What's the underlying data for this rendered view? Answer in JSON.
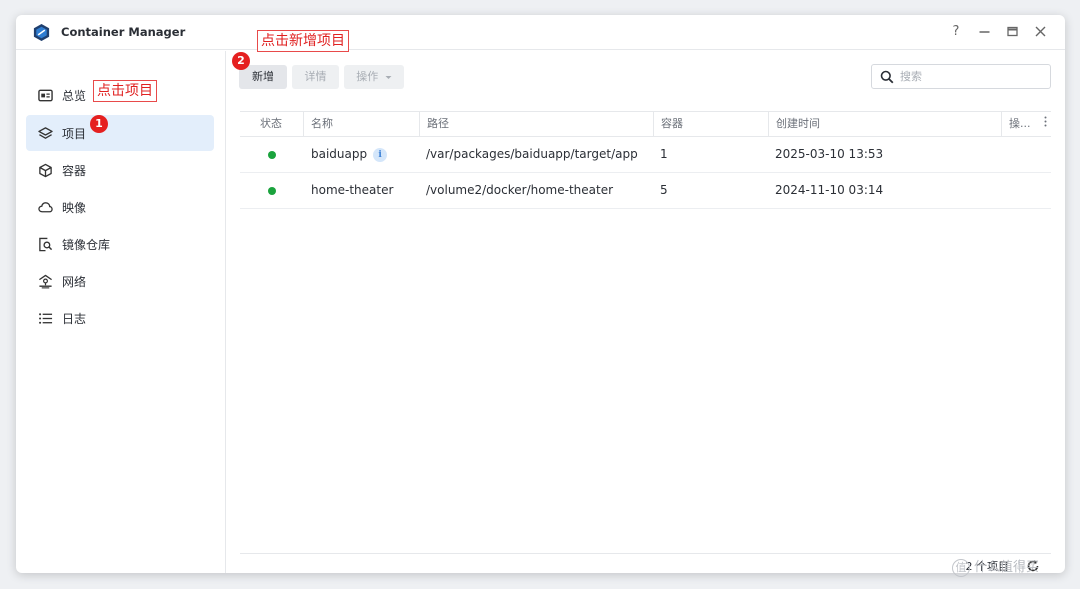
{
  "window": {
    "title": "Container Manager"
  },
  "sidebar": {
    "items": [
      {
        "label": "总览",
        "icon": "overview-icon"
      },
      {
        "label": "项目",
        "icon": "layers-icon",
        "active": true
      },
      {
        "label": "容器",
        "icon": "cube-icon"
      },
      {
        "label": "映像",
        "icon": "cloud-icon"
      },
      {
        "label": "镜像仓库",
        "icon": "registry-search-icon"
      },
      {
        "label": "网络",
        "icon": "network-icon"
      },
      {
        "label": "日志",
        "icon": "log-list-icon"
      }
    ]
  },
  "toolbar": {
    "new_label": "新增",
    "details_label": "详情",
    "action_label": "操作",
    "search_placeholder": "搜索"
  },
  "table": {
    "columns": [
      "状态",
      "名称",
      "路径",
      "容器",
      "创建时间",
      "操..."
    ],
    "rows": [
      {
        "status": "running",
        "name": "baiduapp",
        "path": "/var/packages/baiduapp/target/app",
        "containers": "1",
        "created": "2025-03-10 13:53"
      },
      {
        "status": "running",
        "name": "home-theater",
        "path": "/volume2/docker/home-theater",
        "containers": "5",
        "created": "2024-11-10 03:14"
      }
    ]
  },
  "footer": {
    "count_text": "2 个项目"
  },
  "annotations": {
    "step1_text": "点击项目",
    "step1_badge": "1",
    "step2_text": "点击新增项目",
    "step2_badge": "2"
  },
  "watermark": {
    "text": "什么值得买",
    "logo_text": "值"
  },
  "colors": {
    "accent": "#3a7fd5",
    "active_bg": "#e3eefb",
    "status_running": "#1aa33d",
    "annotation": "#e02222"
  }
}
